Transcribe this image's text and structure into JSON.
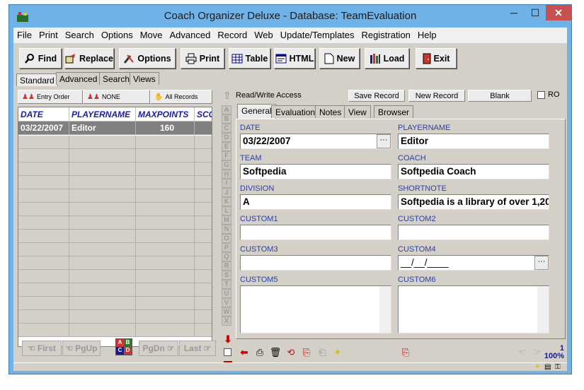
{
  "window": {
    "title": "Coach Organizer Deluxe - Database: TeamEvaluation",
    "min": "─",
    "max": "☐",
    "close": "✕"
  },
  "menu": [
    "File",
    "Print",
    "Search",
    "Options",
    "Move",
    "Advanced",
    "Record",
    "Web",
    "Update/Templates",
    "Registration",
    "Help"
  ],
  "toolbar": {
    "find": "Find",
    "replace": "Replace",
    "options": "Options",
    "print": "Print",
    "table": "Table",
    "html": "HTML",
    "new": "New",
    "load": "Load",
    "exit": "Exit"
  },
  "view_tabs": [
    "Standard",
    "Advanced",
    "Search",
    "Views"
  ],
  "list_buttons": {
    "entry_order": "Entry Order",
    "none": "NONE",
    "all_records": "All Records"
  },
  "grid": {
    "columns": [
      "DATE",
      "PLAYERNAME",
      "MAXPOINTS",
      "SCO"
    ],
    "rows": [
      {
        "date": "03/22/2007",
        "player": "Editor",
        "maxpoints": "160"
      }
    ]
  },
  "nav": {
    "first": "First",
    "pgup": "PgUp",
    "pgdn": "PgDn",
    "last": "Last"
  },
  "alphabet": [
    "A",
    "B",
    "C",
    "D",
    "E",
    "F",
    "G",
    "H",
    "I",
    "J",
    "K",
    "L",
    "M",
    "N",
    "O",
    "P",
    "Q",
    "R",
    "S",
    "T",
    "U",
    "V",
    "W",
    "X"
  ],
  "record_bar": {
    "access": "Read/Write Access",
    "save": "Save Record",
    "new": "New Record",
    "blank": "Blank",
    "ro": "RO"
  },
  "record_tabs": [
    "General",
    "Evaluation",
    "Notes",
    "View",
    "Browser"
  ],
  "fields": {
    "date": {
      "label": "DATE",
      "value": "03/22/2007"
    },
    "playername": {
      "label": "PLAYERNAME",
      "value": "Editor"
    },
    "team": {
      "label": "TEAM",
      "value": "Softpedia"
    },
    "coach": {
      "label": "COACH",
      "value": "Softpedia Coach"
    },
    "division": {
      "label": "DIVISION",
      "value": "A"
    },
    "shortnote": {
      "label": "SHORTNOTE",
      "value": "Softpedia is a library of over 1,20"
    },
    "custom1": {
      "label": "CUSTOM1",
      "value": ""
    },
    "custom2": {
      "label": "CUSTOM2",
      "value": ""
    },
    "custom3": {
      "label": "CUSTOM3",
      "value": ""
    },
    "custom4": {
      "label": "CUSTOM4",
      "value": "__/__/____"
    },
    "custom5": {
      "label": "CUSTOM5",
      "value": ""
    },
    "custom6": {
      "label": "CUSTOM6",
      "value": ""
    }
  },
  "status": {
    "record": "1",
    "zoom": "100%"
  },
  "colors": {
    "accent": "#2b3fa8",
    "title_bar": "#6fb2e8",
    "close": "#c75050",
    "selected_row": "#808080"
  }
}
